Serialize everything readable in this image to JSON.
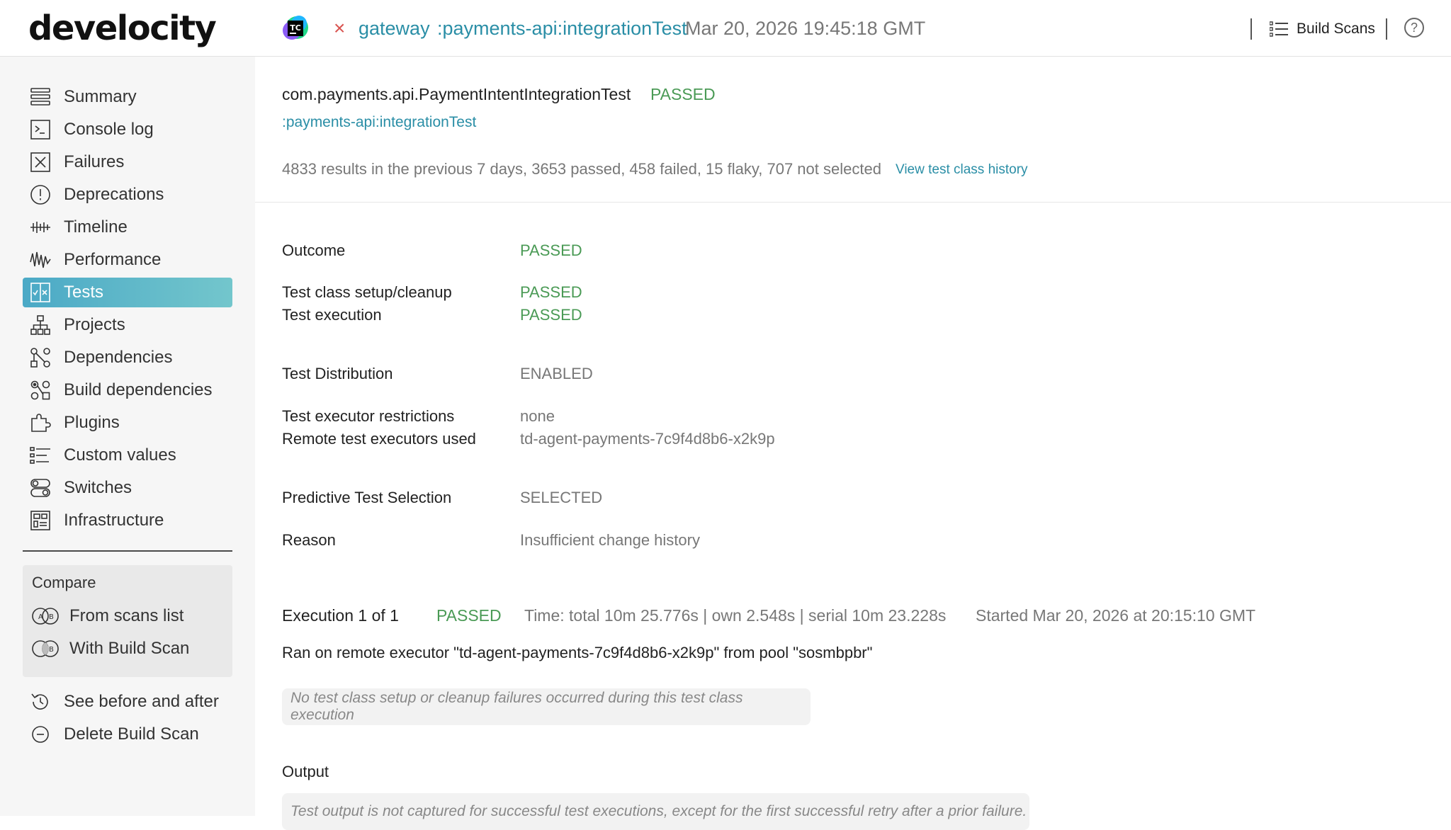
{
  "header": {
    "logo": "develocity",
    "ci_badge": "TC",
    "status_symbol": "×",
    "project": "gateway",
    "task": ":payments-api:integrationTest",
    "timestamp": "Mar 20, 2026 19:45:18 GMT",
    "build_scans_label": "Build Scans",
    "help_symbol": "?"
  },
  "sidebar": {
    "items": [
      {
        "label": "Summary",
        "icon": "summary-icon"
      },
      {
        "label": "Console log",
        "icon": "console-icon"
      },
      {
        "label": "Failures",
        "icon": "failures-icon"
      },
      {
        "label": "Deprecations",
        "icon": "deprecations-icon"
      },
      {
        "label": "Timeline",
        "icon": "timeline-icon"
      },
      {
        "label": "Performance",
        "icon": "performance-icon"
      },
      {
        "label": "Tests",
        "icon": "tests-icon",
        "active": true
      },
      {
        "label": "Projects",
        "icon": "projects-icon"
      },
      {
        "label": "Dependencies",
        "icon": "dependencies-icon"
      },
      {
        "label": "Build dependencies",
        "icon": "build-dependencies-icon"
      },
      {
        "label": "Plugins",
        "icon": "plugins-icon"
      },
      {
        "label": "Custom values",
        "icon": "custom-values-icon"
      },
      {
        "label": "Switches",
        "icon": "switches-icon"
      },
      {
        "label": "Infrastructure",
        "icon": "infrastructure-icon"
      }
    ],
    "compare": {
      "title": "Compare",
      "from_scans_list": "From scans list",
      "with_build_scan": "With Build Scan"
    },
    "see_before_after": "See before and after",
    "delete_build_scan": "Delete Build Scan"
  },
  "main": {
    "class_name": "com.payments.api.PaymentIntentIntegrationTest",
    "class_status": "PASSED",
    "task_link": ":payments-api:integrationTest",
    "history_summary": "4833 results in the previous 7 days, 3653 passed, 458 failed, 15 flaky, 707 not selected",
    "history_link": "View test class history",
    "outcome_label": "Outcome",
    "outcome_value": "PASSED",
    "setup_label": "Test class setup/cleanup",
    "setup_value": "PASSED",
    "execution_label": "Test execution",
    "execution_value": "PASSED",
    "distribution_label": "Test Distribution",
    "distribution_value": "ENABLED",
    "restrictions_label": "Test executor restrictions",
    "restrictions_value": "none",
    "remote_label": "Remote test executors used",
    "remote_value": "td-agent-payments-7c9f4d8b6-x2k9p",
    "pts_label": "Predictive Test Selection",
    "pts_value": "SELECTED",
    "reason_label": "Reason",
    "reason_value": "Insufficient change history",
    "exec_title": "Execution 1 of 1",
    "exec_status": "PASSED",
    "exec_time": "Time: total 10m 25.776s | own 2.548s | serial 10m 23.228s",
    "exec_started": "Started Mar 20, 2026 at 20:15:10 GMT",
    "exec_ran_on": "Ran on remote executor \"td-agent-payments-7c9f4d8b6-x2k9p\" from pool \"sosmbpbr\"",
    "no_failures_note": "No test class setup or cleanup failures occurred during this test class execution",
    "output_label": "Output",
    "output_note": "Test output is not captured for successful test executions, except for the first successful retry after a prior failure."
  },
  "colors": {
    "accent_teal": "#2a8ea6",
    "pass_green": "#4a9a55",
    "fail_red": "#d9534f",
    "active_gradient_start": "#4ba9c6",
    "active_gradient_end": "#73c6cc"
  }
}
